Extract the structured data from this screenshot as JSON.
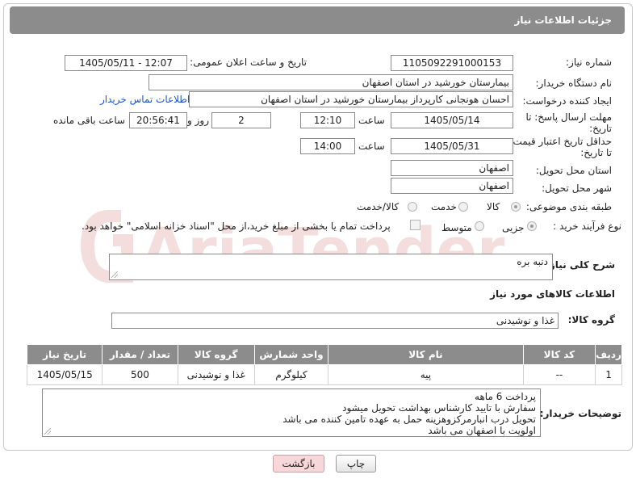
{
  "header": {
    "title": "جزئیات اطلاعات نیاز"
  },
  "form": {
    "need_number": {
      "label": "شماره نیاز:",
      "value": "1105092291000153"
    },
    "announce_datetime": {
      "label": "تاریخ و ساعت اعلان عمومی:",
      "value": "1405/05/11 - 12:07"
    },
    "buyer_org": {
      "label": "نام دستگاه خریدار:",
      "value": "بیمارستان خورشید در استان اصفهان"
    },
    "creator": {
      "label": "ایجاد کننده درخواست:",
      "value": "احسان هونجانی کارپرداز بیمارستان خورشید در استان اصفهان",
      "contact_link": "اطلاعات تماس خریدار"
    },
    "reply_deadline": {
      "label_line1": "مهلت ارسال پاسخ: تا",
      "label_line2": "تاریخ:",
      "date": "1405/05/14",
      "time_label": "ساعت",
      "time": "12:10",
      "days": "2",
      "days_label": "روز و",
      "remaining": "20:56:41",
      "remaining_label": "ساعت باقی مانده"
    },
    "price_validity": {
      "label_line1": "حداقل تاریخ اعتبار قیمت:",
      "label_line2": "تا تاریخ:",
      "date": "1405/05/31",
      "time_label": "ساعت",
      "time": "14:00"
    },
    "delivery_province": {
      "label": "استان محل تحویل:",
      "value": "اصفهان"
    },
    "delivery_city": {
      "label": "شهر محل تحویل:",
      "value": "اصفهان"
    },
    "category": {
      "label": "طبقه بندی موضوعی:",
      "options": [
        "کالا",
        "خدمت",
        "کالا/خدمت"
      ],
      "selected": "کالا"
    },
    "purchase_type": {
      "label": "نوع فرآیند خرید :",
      "options": [
        "جزیی",
        "متوسط"
      ],
      "selected": "جزیی",
      "treasury_note": "پرداخت تمام یا بخشی از مبلغ خرید،از محل \"اسناد خزانه اسلامی\" خواهد بود."
    }
  },
  "description": {
    "label": "شرح کلی نیاز:",
    "value": "دنبه بره"
  },
  "goods_section": {
    "title": "اطلاعات کالاهای مورد نیاز"
  },
  "goods_group": {
    "label": "گروه کالا:",
    "value": "غذا و نوشیدنی"
  },
  "table": {
    "headers": [
      "ردیف",
      "کد کالا",
      "نام کالا",
      "واحد شمارش",
      "گروه کالا",
      "تعداد / مقدار",
      "تاریخ نیاز"
    ],
    "rows": [
      [
        "1",
        "--",
        "پیه",
        "کیلوگرم",
        "غذا و نوشیدنی",
        "500",
        "1405/05/15"
      ]
    ]
  },
  "buyer_notes": {
    "label": "توضیحات خریدار:",
    "lines": [
      "پرداخت 6 ماهه",
      "سفارش با تایید کارشناس بهداشت تحویل میشود",
      "تحویل درب انبارمرکزوهزینه حمل به عهده تامین کننده می باشد",
      "اولویت با اصفهان می باشد"
    ]
  },
  "buttons": {
    "print": "چاپ",
    "back": "بازگشت"
  },
  "watermark_text": "AriaTender.neT",
  "colors": {
    "header_bg": "#8c8c8c",
    "link": "#1a55c8",
    "back_button": "#f8d7da"
  }
}
